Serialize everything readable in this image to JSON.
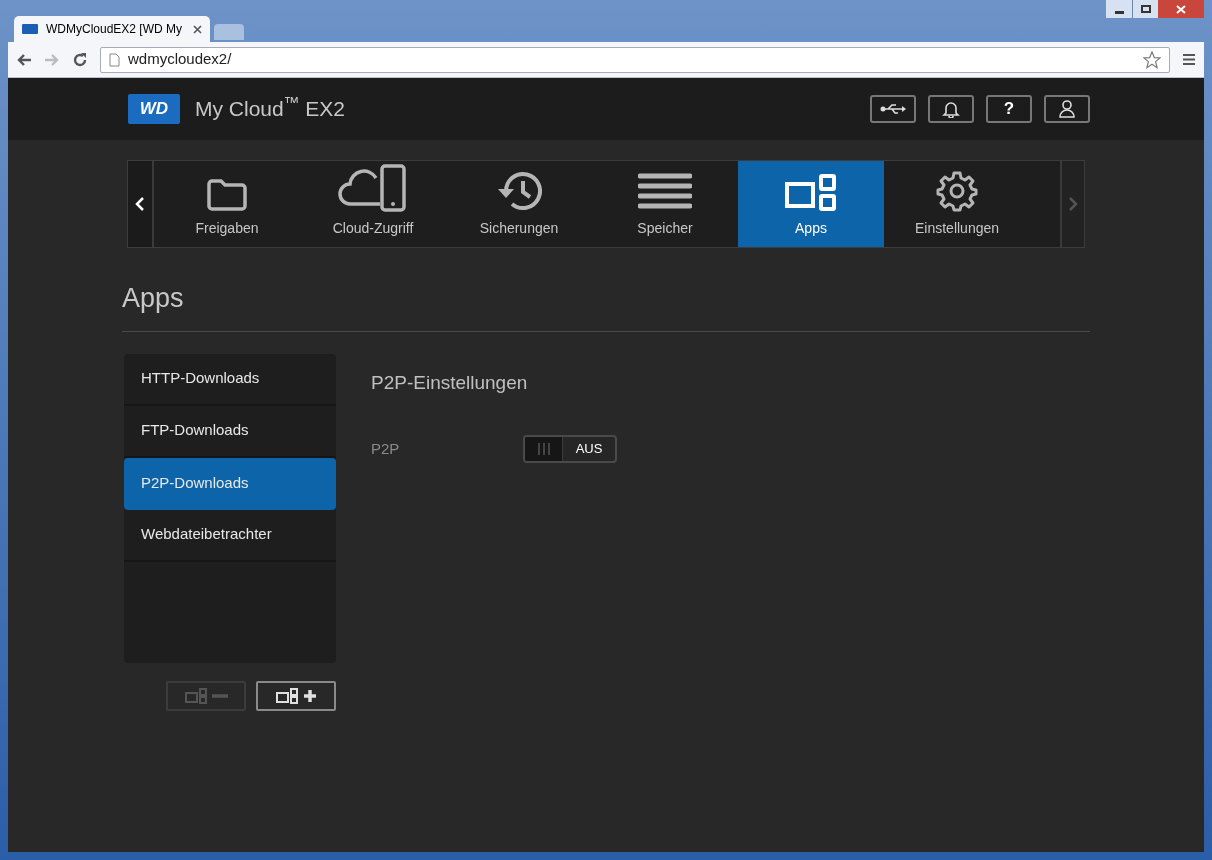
{
  "browser": {
    "tab_title": "WDMyCloudEX2 [WD My",
    "url": "wdmycloudex2/"
  },
  "header": {
    "logo": "WD",
    "brand": "My Cloud$^{™}$ EX2",
    "help": "?"
  },
  "nav": {
    "items": [
      {
        "label": "Freigaben",
        "kind": "folder",
        "selected": false
      },
      {
        "label": "Cloud-Zugriff",
        "kind": "cloud",
        "selected": false
      },
      {
        "label": "Sicherungen",
        "kind": "history",
        "selected": false
      },
      {
        "label": "Speicher",
        "kind": "storage",
        "selected": false
      },
      {
        "label": "Apps",
        "kind": "apps",
        "selected": true
      },
      {
        "label": "Einstellungen",
        "kind": "gear",
        "selected": false
      }
    ]
  },
  "page_title": "Apps",
  "sidebar": {
    "items": [
      {
        "label": "HTTP-Downloads",
        "selected": false
      },
      {
        "label": "FTP-Downloads",
        "selected": false
      },
      {
        "label": "P2P-Downloads",
        "selected": true
      },
      {
        "label": "Webdateibetrachter",
        "selected": false
      }
    ],
    "remove_button": {
      "disabled": true
    },
    "add_button": {
      "disabled": false
    }
  },
  "section": {
    "title": "P2P-Einstellungen",
    "settings": [
      {
        "label": "P2P",
        "on": false,
        "state_text": "AUS"
      }
    ]
  }
}
